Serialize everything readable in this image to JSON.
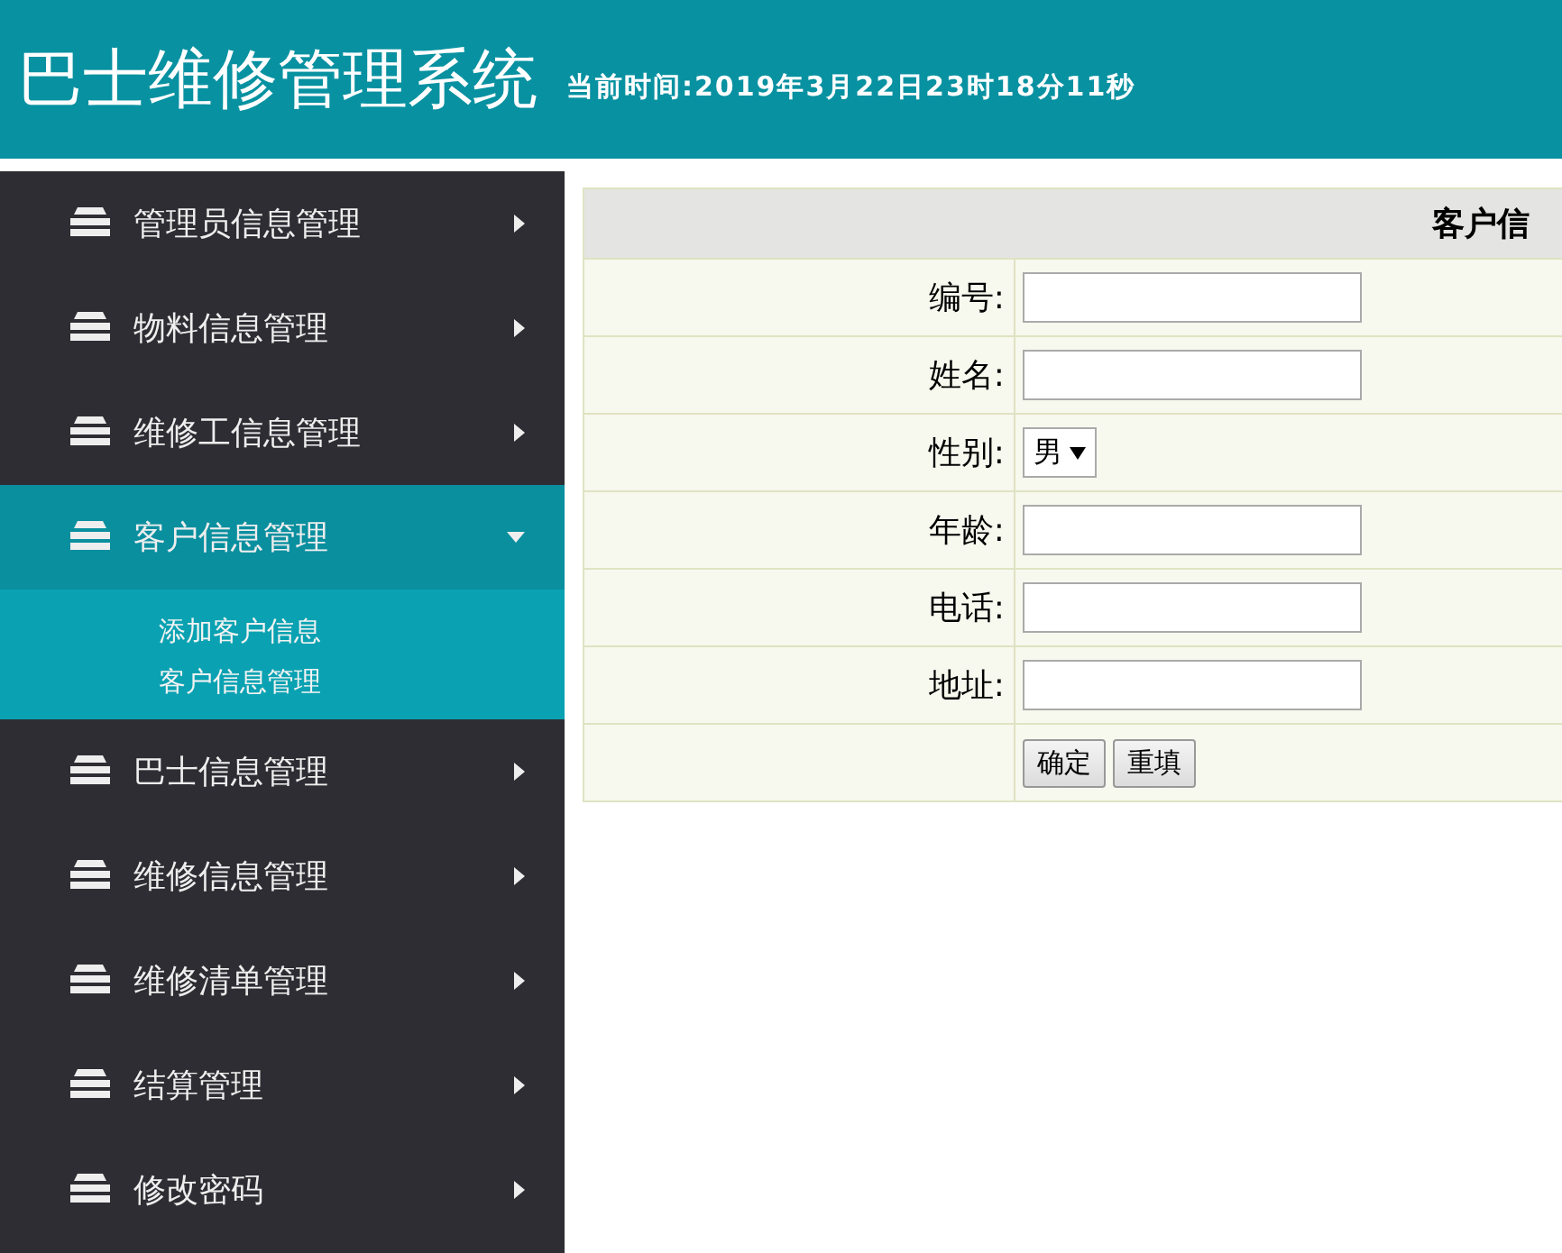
{
  "header": {
    "title": "巴士维修管理系统",
    "clock": "当前时间:2019年3月22日23时18分11秒"
  },
  "sidebar": {
    "items": [
      {
        "label": "管理员信息管理",
        "expanded": false
      },
      {
        "label": "物料信息管理",
        "expanded": false
      },
      {
        "label": "维修工信息管理",
        "expanded": false
      },
      {
        "label": "客户信息管理",
        "expanded": true,
        "children": [
          {
            "label": "添加客户信息"
          },
          {
            "label": "客户信息管理"
          }
        ]
      },
      {
        "label": "巴士信息管理",
        "expanded": false
      },
      {
        "label": "维修信息管理",
        "expanded": false
      },
      {
        "label": "维修清单管理",
        "expanded": false
      },
      {
        "label": "结算管理",
        "expanded": false
      },
      {
        "label": "修改密码",
        "expanded": false
      }
    ]
  },
  "form": {
    "title": "客户信",
    "fields": [
      {
        "label": "编号:",
        "kind": "text"
      },
      {
        "label": "姓名:",
        "kind": "text"
      },
      {
        "label": "性别:",
        "kind": "select",
        "value": "男"
      },
      {
        "label": "年龄:",
        "kind": "text"
      },
      {
        "label": "电话:",
        "kind": "text"
      },
      {
        "label": "地址:",
        "kind": "text"
      }
    ],
    "buttons": [
      "确定",
      "重填"
    ]
  }
}
